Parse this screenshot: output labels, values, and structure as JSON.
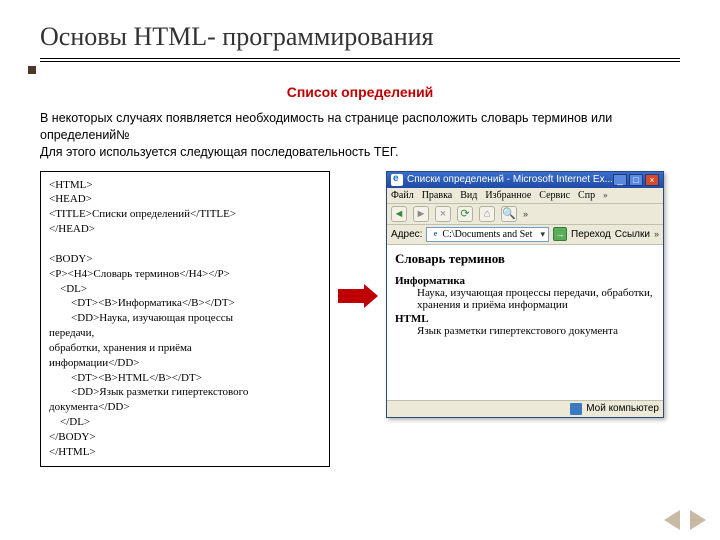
{
  "title": "Основы HTML- программирования",
  "subtitle": "Список определений",
  "intro_line1": "В некоторых случаях появляется необходимость на странице расположить словарь терминов или определений№",
  "intro_line2": "Для этого используется следующая последовательность ТЕГ.",
  "code": "<HTML>\n<HEAD>\n<TITLE>Списки определений</TITLE>\n</HEAD>\n\n<BODY>\n<P><H4>Словарь терминов</H4></P>\n    <DL>\n        <DT><B>Информатика</B></DT>\n        <DD>Наука, изучающая процессы\nпередачи,\nобработки, хранения и приёма\nинформации</DD>\n        <DT><B>HTML</B></DT>\n        <DD>Язык разметки гипертекстового\nдокумента</DD>\n    </DL>\n</BODY>\n</HTML>",
  "browser": {
    "title_text": "Списки определений - Microsoft Internet Ex...",
    "menu": [
      "Файл",
      "Правка",
      "Вид",
      "Избранное",
      "Сервис",
      "Спр"
    ],
    "addr_label": "Адрес:",
    "addr_value": "C:\\Documents and Set",
    "go_label": "Переход",
    "links_label": "Ссылки",
    "content": {
      "heading": "Словарь терминов",
      "items": [
        {
          "term": "Информатика",
          "def": "Наука, изучающая процессы передачи, обработки, хранения и приёма информации"
        },
        {
          "term": "HTML",
          "def": "Язык разметки гипертекстового документа"
        }
      ]
    },
    "status": "Мой компьютер"
  }
}
